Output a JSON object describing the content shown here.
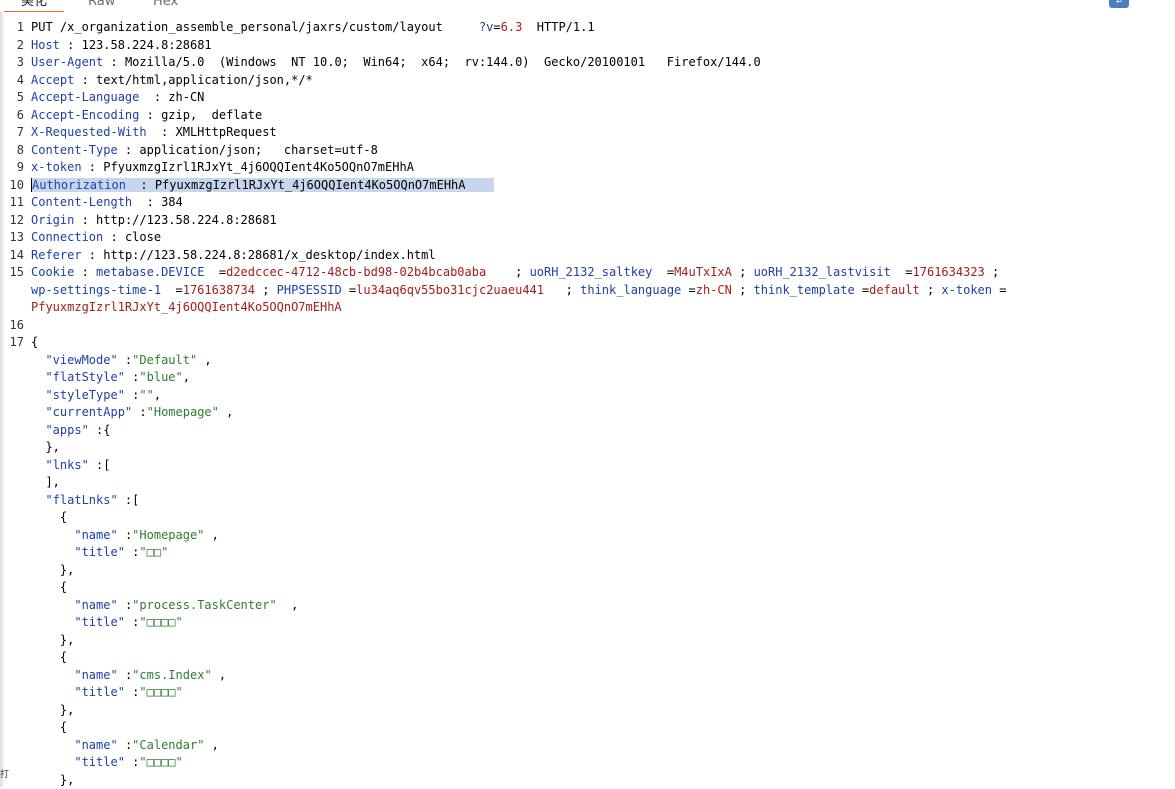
{
  "tabs": {
    "pretty": "美化",
    "raw": "Raw",
    "hex": "Hex"
  },
  "toolbar": {
    "wrap_icon": "wrap-lines-icon",
    "wrap_symbol": "⇄"
  },
  "request": {
    "line1": {
      "method": "PUT",
      "path": " /x_organization_assemble_personal/jaxrs/custom/layout",
      "q_key": "?v",
      "q_eq": "=",
      "q_val": "6.3",
      "proto": "HTTP/1.1"
    },
    "headers": [
      {
        "name": "Host",
        "value": "123.58.224.8:28681"
      },
      {
        "name": "User-Agent",
        "value": "Mozilla/5.0  (Windows  NT 10.0;  Win64;  x64;  rv:144.0)  Gecko/20100101   Firefox/144.0"
      },
      {
        "name": "Accept",
        "value": "text/html,application/json,*/*"
      },
      {
        "name": "Accept-Language",
        "value": "zh-CN"
      },
      {
        "name": "Accept-Encoding",
        "value": "gzip,  deflate"
      },
      {
        "name": "X-Requested-With",
        "value": "XMLHttpRequest"
      },
      {
        "name": "Content-Type",
        "value": "application/json;   charset=utf-8"
      },
      {
        "name": "x-token",
        "value": "PfyuxmzgIzrl1RJxYt_4j6OQQIent4Ko5OQnO7mEHhA"
      },
      {
        "name": "Authorization",
        "value": "PfyuxmzgIzrl1RJxYt_4j6OQQIent4Ko5OQnO7mEHhA"
      },
      {
        "name": "Content-Length",
        "value": "384"
      },
      {
        "name": "Origin",
        "value": "http://123.58.224.8:28681"
      },
      {
        "name": "Connection",
        "value": "close"
      },
      {
        "name": "Referer",
        "value": "http://123.58.224.8:28681/x_desktop/index.html"
      }
    ],
    "cookie": {
      "name": "Cookie",
      "pairs": [
        {
          "k": "metabase.DEVICE",
          "v": "d2edccec-4712-48cb-bd98-02b4bcab0aba"
        },
        {
          "k": "uoRH_2132_saltkey",
          "v": "M4uTxIxA"
        },
        {
          "k": "uoRH_2132_lastvisit",
          "v": "1761634323"
        },
        {
          "k": "wp-settings-time-1",
          "v": "1761638734"
        },
        {
          "k": "PHPSESSID",
          "v": "lu34aq6qv55bo31cjc2uaeu441"
        },
        {
          "k": "think_language",
          "v": "zh-CN"
        },
        {
          "k": "think_template",
          "v": "default"
        },
        {
          "k": "x-token",
          "v": "PfyuxmzgIzrl1RJxYt_4j6OQQIent4Ko5OQnO7mEHhA"
        }
      ]
    },
    "body": {
      "viewMode": "Default",
      "flatStyle": "blue",
      "styleType": "",
      "currentApp": "Homepage",
      "flatLnks": [
        {
          "name": "Homepage",
          "title": "□□"
        },
        {
          "name": "process.TaskCenter",
          "title": "□□□□"
        },
        {
          "name": "cms.Index",
          "title": "□□□□"
        },
        {
          "name": "Calendar",
          "title": "□□□□"
        }
      ]
    }
  },
  "line_numbers": [
    "1",
    "2",
    "3",
    "4",
    "5",
    "6",
    "7",
    "8",
    "9",
    "10",
    "11",
    "12",
    "13",
    "14",
    "15",
    "16",
    "17"
  ],
  "side_mark": "打"
}
